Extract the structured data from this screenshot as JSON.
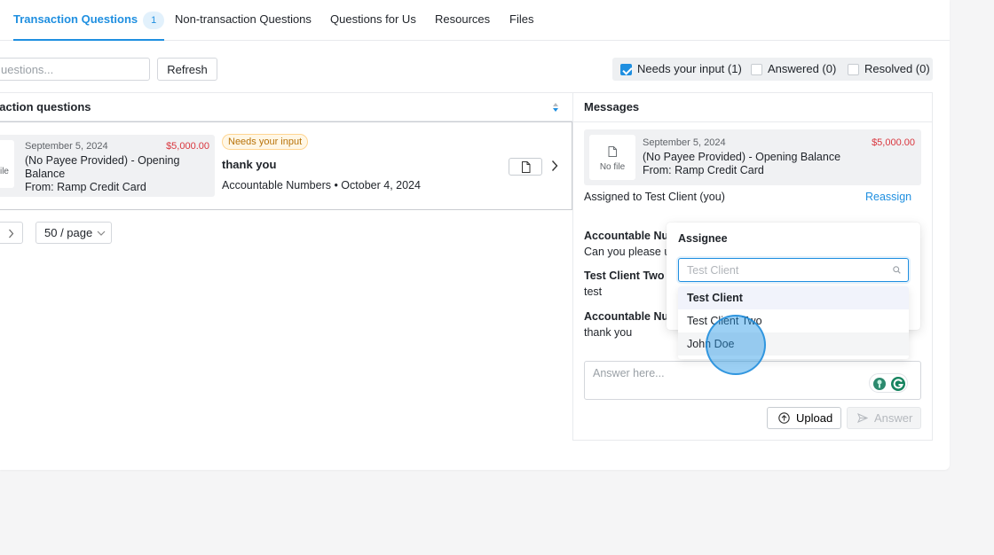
{
  "tabs": [
    {
      "label": "Transaction Questions",
      "count": "1"
    },
    {
      "label": "Non-transaction Questions"
    },
    {
      "label": "Questions for Us"
    },
    {
      "label": "Resources"
    },
    {
      "label": "Files"
    }
  ],
  "toolbar": {
    "search_placeholder": "uestions...",
    "refresh_label": "Refresh"
  },
  "filters": [
    {
      "label": "Needs your input (1)",
      "checked": true
    },
    {
      "label": "Answered (0)",
      "checked": false
    },
    {
      "label": "Resolved (0)",
      "checked": false
    }
  ],
  "list": {
    "title": "saction questions",
    "rows": [
      {
        "file_label": "ile",
        "date": "September 5, 2024",
        "amount": "$5,000.00",
        "description": "(No Payee Provided) - Opening Balance",
        "from": "From: Ramp Credit Card",
        "status": "Needs your input",
        "question": "thank you",
        "meta": "Accountable Numbers • October 4, 2024"
      }
    ],
    "page_size": "50 / page"
  },
  "messages": {
    "title": "Messages",
    "txn": {
      "file_label": "No file",
      "date": "September 5, 2024",
      "amount": "$5,000.00",
      "description": "(No Payee Provided) - Opening Balance",
      "from": "From: Ramp Credit Card"
    },
    "assigned": "Assigned to Test Client (you)",
    "reassign_label": "Reassign",
    "thread": [
      {
        "author": "Accountable Nur",
        "body": "Can you please u"
      },
      {
        "author": "Test Client Two",
        "body": "test"
      },
      {
        "author": "Accountable Nur",
        "body": "thank you"
      }
    ],
    "answer_placeholder": "Answer here...",
    "upload_label": "Upload",
    "answer_label": "Answer"
  },
  "assignee_dropdown": {
    "title": "Assignee",
    "search_placeholder": "Test Client",
    "options": [
      "Test Client",
      "Test Client Two",
      "John Doe"
    ],
    "selected": "Test Client"
  },
  "colors": {
    "accent": "#1f8fe0",
    "amount": "#d9363e",
    "badge_text": "#b8730a"
  }
}
